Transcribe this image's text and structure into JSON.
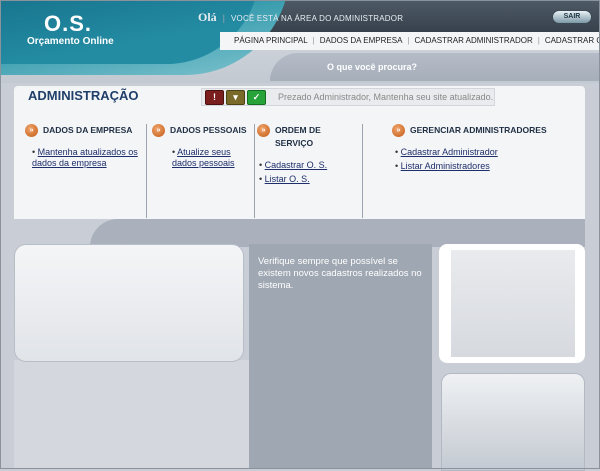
{
  "header": {
    "logo_title": "O.S.",
    "logo_subtitle": "Orçamento Online",
    "greeting": "Olá",
    "greeting_message": "VOCÊ ESTÁ NA ÁREA DO ADMINISTRADOR",
    "logout_label": "SAIR",
    "nav": [
      "PÁGINA PRINCIPAL",
      "DADOS DA EMPRESA",
      "CADASTRAR ADMINISTRADOR",
      "CADASTRAR O.S."
    ],
    "search_label": "O que você procura?"
  },
  "main": {
    "title": "ADMINISTRAÇÃO",
    "status_icons": [
      "alert-icon",
      "arrow-down-icon",
      "check-icon"
    ],
    "status_message": "Prezado Administrador, Mantenha seu site atualizado.",
    "sections": [
      {
        "title": "DADOS DA EMPRESA",
        "links": [
          "Mantenha atualizados os dados da empresa"
        ]
      },
      {
        "title": "DADOS PESSOAIS",
        "links": [
          "Atualize seus dados pessoais"
        ]
      },
      {
        "title": "ORDEM DE SERVIÇO",
        "links": [
          "Cadastrar O. S.",
          "Listar O. S."
        ]
      },
      {
        "title": "GERENCIAR ADMINISTRADORES",
        "links": [
          "Cadastrar Administrador",
          "Listar Administradores"
        ]
      }
    ],
    "notice": "Verifique sempre que possível se existem novos cadastros realizados no sistema."
  },
  "colors": {
    "accent_teal": "#238ba2",
    "title_blue": "#1f3f6a",
    "link_blue": "#1d2e6a",
    "bullet_orange": "#c25a17"
  }
}
